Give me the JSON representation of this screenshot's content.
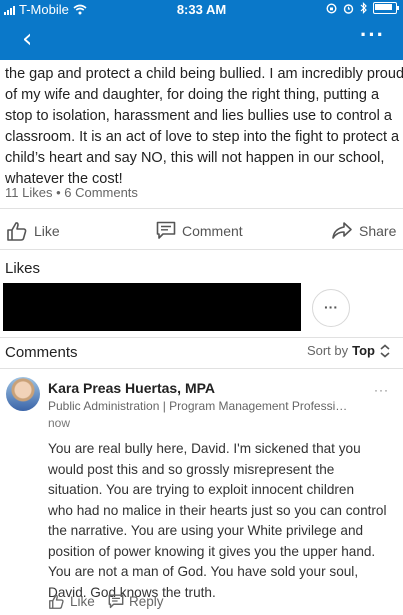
{
  "status_bar": {
    "carrier": "T-Mobile",
    "time": "8:33 AM"
  },
  "nav": {
    "back_icon": "chevron-left-icon",
    "more_icon": "more-horizontal-icon"
  },
  "post": {
    "lines": [
      "the gap and protect a child being bullied. I am incredibly proud",
      "of my wife and daughter, for doing the right thing, putting a",
      "stop to isolation, harassment and lies bullies use to control a",
      "classroom. It is an act of love to step into the fight to protect a",
      "child’s heart and say NO, this will not happen in our school,",
      "whatever the cost!"
    ],
    "counts": "11 Likes • 6 Comments"
  },
  "actions": {
    "like": "Like",
    "comment": "Comment",
    "share": "Share"
  },
  "likes_section": {
    "title": "Likes",
    "more": "···"
  },
  "comments_section": {
    "title": "Comments",
    "sort_label": "Sort by",
    "sort_value": "Top"
  },
  "comment": {
    "author": "Kara Preas Huertas, MPA",
    "headline": "Public Administration | Program Management Professi…",
    "time": "now",
    "more": "···",
    "lines": [
      "You are real bully here, David. I'm sickened that you",
      "would post this and so grossly misrepresent the",
      "situation.  You are trying to exploit innocent children",
      "who had no malice in their hearts just so you can control",
      "the narrative. You are using your White privilege and",
      "position of power knowing it gives you the upper hand.",
      "You are not a man of God.  You have sold your soul,",
      "David. God knows the truth."
    ],
    "like": "Like",
    "reply": "Reply"
  },
  "colors": {
    "brand_blue": "#0a78c9"
  }
}
